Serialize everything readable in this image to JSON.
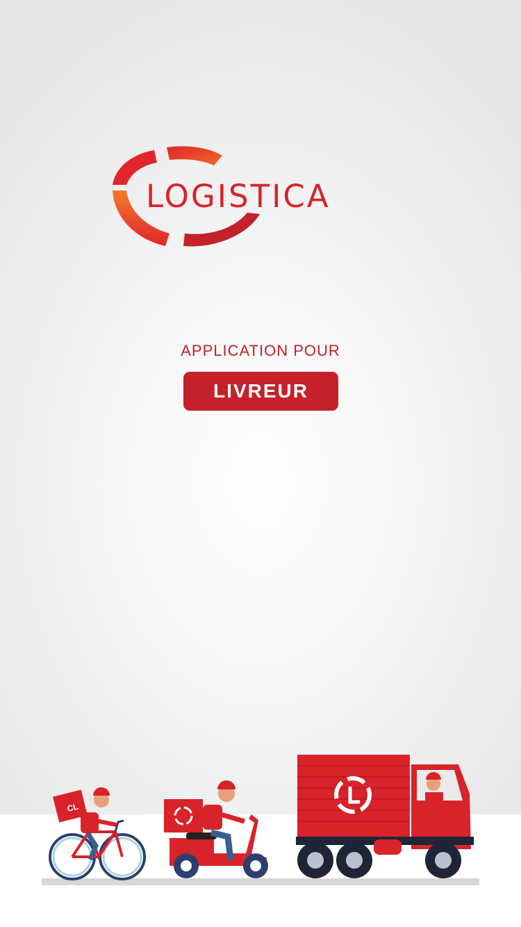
{
  "brand": {
    "name": "LOGISTICA",
    "colors": {
      "red": "#d8232a",
      "orange": "#f06a2a",
      "dark_red": "#c4212a"
    }
  },
  "splash": {
    "subtitle": "APPLICATION POUR",
    "role_label": "LIVREUR"
  },
  "illustration": {
    "vehicles": [
      "bicycle-courier",
      "scooter-courier",
      "delivery-truck"
    ],
    "box_logo": "CL"
  }
}
